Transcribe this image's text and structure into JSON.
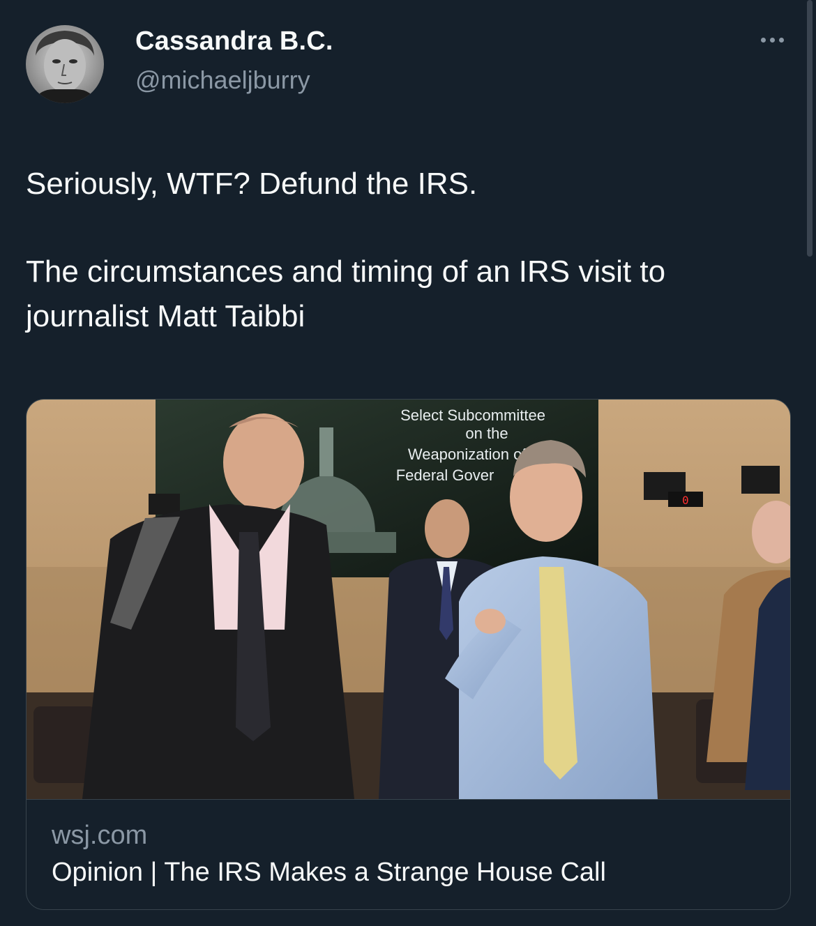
{
  "author": {
    "display_name": "Cassandra B.C.",
    "handle": "@michaeljburry"
  },
  "tweet": {
    "line1": "Seriously, WTF? Defund the IRS.",
    "line2": "The circumstances and timing of an IRS visit to journalist Matt Taibbi"
  },
  "link_card": {
    "image_sign_text": [
      "Select Subcommittee",
      "on the",
      "Weaponization of the",
      "Federal Gover"
    ],
    "image_counter_text": "0",
    "domain": "wsj.com",
    "title": "Opinion | The IRS Makes a Strange House Call"
  },
  "icons": {
    "more": "more-options-icon"
  },
  "colors": {
    "background": "#15202b",
    "primary_text": "#f7f9f9",
    "secondary_text": "#8b98a5",
    "border": "#38444d"
  }
}
